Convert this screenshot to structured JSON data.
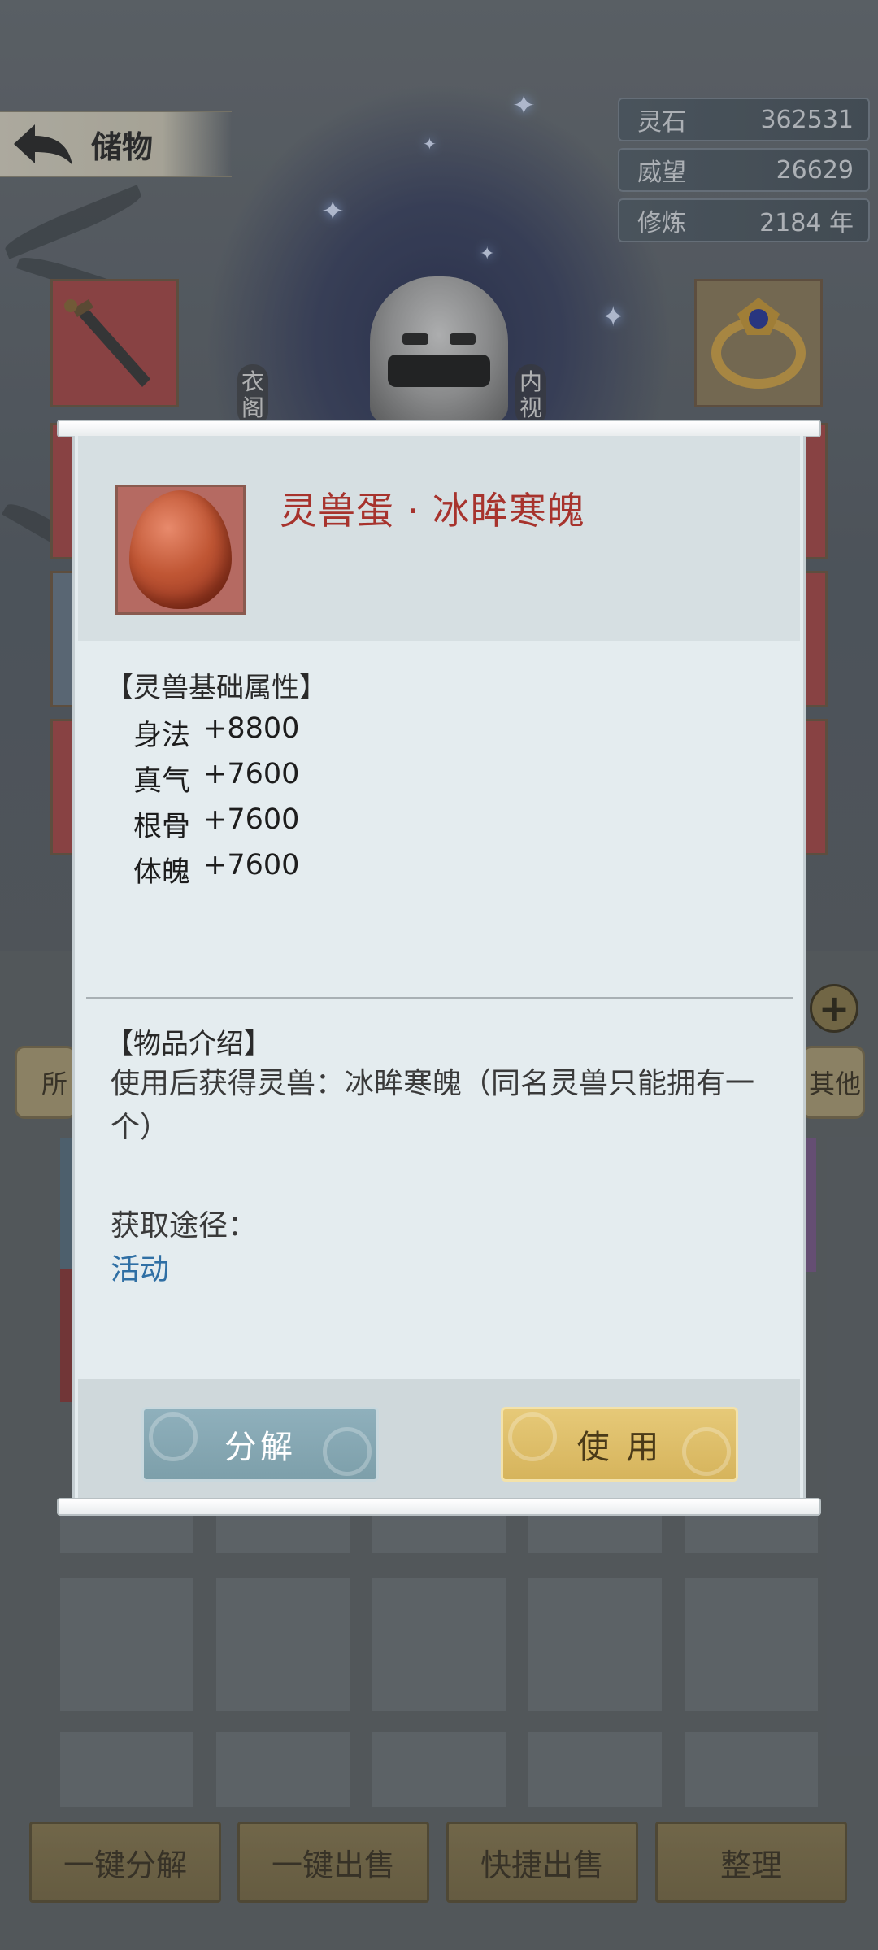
{
  "header": {
    "title": "储物"
  },
  "stats": [
    {
      "label": "灵石",
      "value": "362531"
    },
    {
      "label": "威望",
      "value": "26629"
    },
    {
      "label": "修炼",
      "value": "2184 年"
    }
  ],
  "equipment_labels": {
    "left": "衣阁",
    "right": "内视"
  },
  "tabs_peek": {
    "left": "所",
    "right": "其他"
  },
  "popup": {
    "item_name": "灵兽蛋 · 冰眸寒魄",
    "attr_title": "【灵兽基础属性】",
    "attributes": [
      {
        "name": "身法",
        "value": "+8800"
      },
      {
        "name": "真气",
        "value": "+7600"
      },
      {
        "name": "根骨",
        "value": "+7600"
      },
      {
        "name": "体魄",
        "value": "+7600"
      }
    ],
    "intro_title": "【物品介绍】",
    "description": "使用后获得灵兽：冰眸寒魄（同名灵兽只能拥有一个）",
    "source_label": "获取途径：",
    "source_value": "活动",
    "decompose_label": "分解",
    "use_label": "使 用"
  },
  "bottom_actions": {
    "decompose_all": "一键分解",
    "sell_all": "一键出售",
    "quick_sell": "快捷出售",
    "sort": "整理"
  }
}
